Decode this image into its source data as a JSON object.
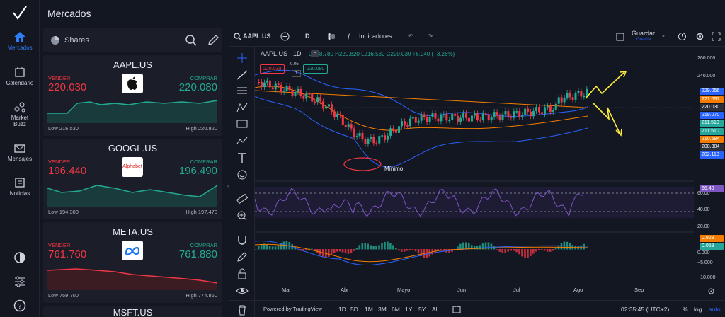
{
  "nav": {
    "items": [
      {
        "label": "Mercados",
        "icon": "home-icon"
      },
      {
        "label": "Calendario",
        "icon": "calendar-icon"
      },
      {
        "label": "Market\nBuzz",
        "icon": "buzz-icon"
      },
      {
        "label": "Mensajes",
        "icon": "mail-icon"
      },
      {
        "label": "Noticias",
        "icon": "news-icon"
      }
    ]
  },
  "panel": {
    "title": "Mercados",
    "filter": "Shares",
    "cards": [
      {
        "symbol": "AAPL.US",
        "sell_label": "VENDER",
        "buy_label": "COMPRAR",
        "sell": "220.030",
        "buy": "220.080",
        "low": "Low 216.530",
        "high": "High 220.820",
        "brand": "apple-logo",
        "brand_text": ""
      },
      {
        "symbol": "GOOGL.US",
        "sell_label": "VENDER",
        "buy_label": "COMPRAR",
        "sell": "196.440",
        "buy": "196.490",
        "low": "Low 194.300",
        "high": "High 197.470",
        "brand": "alphabet-logo",
        "brand_text": "Alphabet"
      },
      {
        "symbol": "META.US",
        "sell_label": "VENDER",
        "buy_label": "COMPRAR",
        "sell": "761.760",
        "buy": "761.880",
        "low": "Low 759.700",
        "high": "High 774.860",
        "brand": "meta-logo",
        "brand_text": ""
      },
      {
        "symbol": "MSFT.US"
      }
    ]
  },
  "toolbar": {
    "symbol": "AAPL.US",
    "interval": "D",
    "indicators": "Indicadores",
    "save": "Guardar",
    "save_sub": "Guardar"
  },
  "chart": {
    "legend_symbol": "AAPL.US · 1D",
    "o": "O218.780",
    "h": "H220.820",
    "l": "L216.530",
    "c": "C220.030",
    "change": "+6.940 (+3.26%)",
    "sell_box": "220.030",
    "spread": "0.05",
    "qty": "1",
    "buy_box": "220.080",
    "minimo": "Mínimo",
    "axis_ticks": [
      "260.000",
      "240.000",
      "60.00",
      "40.00",
      "20.00",
      "0.000",
      "−5.000",
      "−10.000"
    ],
    "tags": [
      {
        "v": "229.056",
        "c": "#2962ff"
      },
      {
        "v": "221.097",
        "c": "#f57c00"
      },
      {
        "v": "220.030",
        "c": "#2a2e39"
      },
      {
        "v": "219.070",
        "c": "#2962ff"
      },
      {
        "v": "211.510",
        "c": "#26a69a"
      },
      {
        "v": "211.510",
        "c": "#26a69a"
      },
      {
        "v": "210.594",
        "c": "#f57c00"
      },
      {
        "v": "208.304",
        "c": "#2a2e39"
      },
      {
        "v": "202.118",
        "c": "#2962ff"
      },
      {
        "v": "66.40",
        "c": "#7e57c2"
      },
      {
        "v": "0.929",
        "c": "#f57c00"
      },
      {
        "v": "0.059",
        "c": "#26a69a"
      }
    ],
    "months": [
      "Mar",
      "Abr",
      "Mayo",
      "Jun",
      "Jul",
      "Ago",
      "Sep"
    ]
  },
  "bottom": {
    "powered": "Powered by TradingView",
    "ranges": [
      "1D",
      "5D",
      "1M",
      "3M",
      "6M",
      "1Y",
      "5Y",
      "All"
    ],
    "time": "02:35:45 (UTC+2)",
    "pct": "%",
    "log": "log",
    "auto": "auto"
  },
  "colors": {
    "up": "#22ab94",
    "down": "#f23645",
    "accent": "#2f7df6",
    "bb": "#2962ff",
    "ma": "#f57c00",
    "rsi": "#7e57c2"
  }
}
